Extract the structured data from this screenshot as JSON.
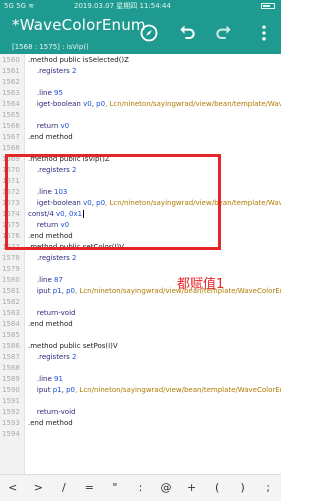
{
  "status": {
    "signal": "5G 5G ≋",
    "time": "2019.03.07 星期四 11:54:44"
  },
  "toolbar": {
    "title": "*WaveColorEnum",
    "subtitle": "[1568 : 1575] : isVip()",
    "icons": [
      "compass-icon",
      "undo-icon",
      "redo-icon",
      "more-vert-icon"
    ]
  },
  "code_lines": [
    {
      "ln": "1560",
      "tokens": [
        {
          "t": ".method public isSelected()Z",
          "c": "kw"
        }
      ]
    },
    {
      "ln": "1561",
      "tokens": [
        {
          "t": "    .registers ",
          "c": "dir"
        },
        {
          "t": "2",
          "c": "num"
        }
      ]
    },
    {
      "ln": "1562",
      "tokens": []
    },
    {
      "ln": "1563",
      "tokens": [
        {
          "t": "    .line ",
          "c": "dir"
        },
        {
          "t": "95",
          "c": "num"
        }
      ]
    },
    {
      "ln": "1564",
      "tokens": [
        {
          "t": "    iget-boolean ",
          "c": "ident"
        },
        {
          "t": "v0",
          "c": "num"
        },
        {
          "t": ", ",
          "c": "txt"
        },
        {
          "t": "p0",
          "c": "num"
        },
        {
          "t": ", Lcn/nineton/sayingwrad/view/bean/template/WaveCo",
          "c": "str"
        }
      ]
    },
    {
      "ln": "1565",
      "tokens": []
    },
    {
      "ln": "1566",
      "tokens": [
        {
          "t": "    return ",
          "c": "ident"
        },
        {
          "t": "v0",
          "c": "num"
        }
      ]
    },
    {
      "ln": "1567",
      "tokens": [
        {
          "t": ".end method",
          "c": "kw"
        }
      ]
    },
    {
      "ln": "1568",
      "tokens": []
    },
    {
      "ln": "1569",
      "tokens": [
        {
          "t": ".method public isVip()Z",
          "c": "kw"
        }
      ]
    },
    {
      "ln": "1570",
      "tokens": [
        {
          "t": "    .registers ",
          "c": "dir"
        },
        {
          "t": "2",
          "c": "num"
        }
      ]
    },
    {
      "ln": "1571",
      "tokens": []
    },
    {
      "ln": "1572",
      "tokens": [
        {
          "t": "    .line ",
          "c": "dir"
        },
        {
          "t": "103",
          "c": "num"
        }
      ]
    },
    {
      "ln": "1573",
      "tokens": [
        {
          "t": "    iget-boolean ",
          "c": "ident"
        },
        {
          "t": "v0",
          "c": "num"
        },
        {
          "t": ", ",
          "c": "txt"
        },
        {
          "t": "p0",
          "c": "num"
        },
        {
          "t": ", Lcn/nineton/sayingwrad/view/bean/template/WaveCo",
          "c": "str"
        }
      ]
    },
    {
      "ln": "1574",
      "tokens": [
        {
          "t": "const/4 ",
          "c": "ident"
        },
        {
          "t": "v0, 0x1",
          "c": "num"
        },
        {
          "t": "",
          "c": "cursor"
        }
      ]
    },
    {
      "ln": "1575",
      "tokens": [
        {
          "t": "    return ",
          "c": "ident"
        },
        {
          "t": "v0",
          "c": "num"
        }
      ]
    },
    {
      "ln": "1576",
      "tokens": [
        {
          "t": ".end method",
          "c": "kw"
        }
      ]
    },
    {
      "ln": "1577",
      "tokens": [
        {
          "t": ".method public setColor(I)V",
          "c": "kw"
        }
      ]
    },
    {
      "ln": "1578",
      "tokens": [
        {
          "t": "    .registers ",
          "c": "dir"
        },
        {
          "t": "2",
          "c": "num"
        }
      ]
    },
    {
      "ln": "1579",
      "tokens": []
    },
    {
      "ln": "1580",
      "tokens": [
        {
          "t": "    .line ",
          "c": "dir"
        },
        {
          "t": "87",
          "c": "num"
        }
      ]
    },
    {
      "ln": "1581",
      "tokens": [
        {
          "t": "    iput ",
          "c": "ident"
        },
        {
          "t": "p1",
          "c": "num"
        },
        {
          "t": ", ",
          "c": "txt"
        },
        {
          "t": "p0",
          "c": "num"
        },
        {
          "t": ", Lcn/nineton/sayingwrad/view/bean/template/WaveColorEnum",
          "c": "str"
        }
      ]
    },
    {
      "ln": "1582",
      "tokens": []
    },
    {
      "ln": "1583",
      "tokens": [
        {
          "t": "    return-void",
          "c": "ident"
        }
      ]
    },
    {
      "ln": "1584",
      "tokens": [
        {
          "t": ".end method",
          "c": "kw"
        }
      ]
    },
    {
      "ln": "1585",
      "tokens": []
    },
    {
      "ln": "1586",
      "tokens": [
        {
          "t": ".method public setPos(I)V",
          "c": "kw"
        }
      ]
    },
    {
      "ln": "1587",
      "tokens": [
        {
          "t": "    .registers ",
          "c": "dir"
        },
        {
          "t": "2",
          "c": "num"
        }
      ]
    },
    {
      "ln": "1588",
      "tokens": []
    },
    {
      "ln": "1589",
      "tokens": [
        {
          "t": "    .line ",
          "c": "dir"
        },
        {
          "t": "91",
          "c": "num"
        }
      ]
    },
    {
      "ln": "1590",
      "tokens": [
        {
          "t": "    iput ",
          "c": "ident"
        },
        {
          "t": "p1",
          "c": "num"
        },
        {
          "t": ", ",
          "c": "txt"
        },
        {
          "t": "p0",
          "c": "num"
        },
        {
          "t": ", Lcn/nineton/sayingwrad/view/bean/template/WaveColorEnum",
          "c": "str"
        }
      ]
    },
    {
      "ln": "1591",
      "tokens": []
    },
    {
      "ln": "1592",
      "tokens": [
        {
          "t": "    return-void",
          "c": "ident"
        }
      ]
    },
    {
      "ln": "1593",
      "tokens": [
        {
          "t": ".end method",
          "c": "kw"
        }
      ]
    },
    {
      "ln": "1594",
      "tokens": []
    }
  ],
  "annotation": "都赋值1",
  "symbols": [
    "<",
    ">",
    "/",
    "=",
    "\"",
    ":",
    "@",
    "+",
    "(",
    ")",
    ";"
  ],
  "colors": {
    "toolbar": "#1f9a90",
    "highlight": "#e3262a"
  }
}
